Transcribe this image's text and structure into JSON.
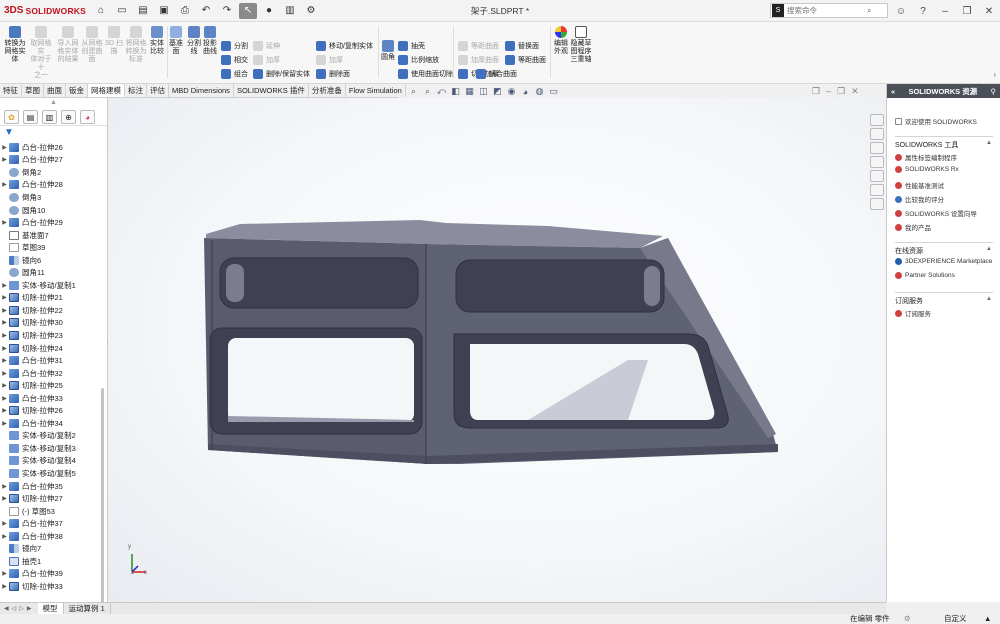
{
  "app": {
    "logo_ds": "3DS",
    "logo_text": "SOLIDWORKS",
    "doc_title": "架子.SLDPRT *"
  },
  "search": {
    "placeholder": "搜索命令"
  },
  "ribbon": {
    "convert_mesh": [
      "转换为",
      "网格实",
      "体"
    ],
    "mesh_large": [
      "取网格实",
      "体对于十",
      "之一"
    ],
    "import_mesh": [
      "导入网",
      "格实体",
      "的结果"
    ],
    "mesh_surface": [
      "从网格",
      "创建曲",
      "面"
    ],
    "scan3d": [
      "3D 扫",
      "描"
    ],
    "mesh_std": [
      "将网格",
      "转换为",
      "标准"
    ],
    "solid_compare": [
      "实体",
      "比较"
    ],
    "ref_plane": [
      "基准",
      "面"
    ],
    "split_line": [
      "分割",
      "线"
    ],
    "project_curve": [
      "投影",
      "曲线"
    ],
    "split": "分割",
    "intersect": "相交",
    "combine": "组合",
    "move_copy": "移动/复制实体",
    "extend": "延伸",
    "thicken": "加厚",
    "delete_keep": "删除/保留实体",
    "delete_face": "删除面",
    "fillet": "圆角",
    "shell": "抽壳",
    "scale": "比例缩放",
    "cut_with_surface": "使用曲面切除",
    "offset_surface": "等距曲面",
    "thicken_surface": "加厚曲面",
    "cut_thicken": "切除加厚",
    "replace_face": "替换面",
    "equidistant_surface": "等距曲面",
    "mirror_face": "镜合曲面",
    "edit_appearance": [
      "编辑",
      "外观"
    ],
    "sketch_program": [
      "隐藏草",
      "图程序",
      "三重轴"
    ]
  },
  "cmd_tabs": [
    "特征",
    "草图",
    "曲面",
    "钣金",
    "网格建模",
    "标注",
    "评估",
    "MBD Dimensions",
    "SOLIDWORKS 插件",
    "分析准备",
    "Flow Simulation"
  ],
  "active_cmd_tab": 4,
  "tree_items": [
    {
      "label": "凸台-拉伸26",
      "type": "boss",
      "expand": true
    },
    {
      "label": "凸台-拉伸27",
      "type": "boss",
      "expand": true
    },
    {
      "label": "倒角2",
      "type": "fillet",
      "expand": false
    },
    {
      "label": "凸台-拉伸28",
      "type": "boss",
      "expand": true
    },
    {
      "label": "倒角3",
      "type": "fillet",
      "expand": false
    },
    {
      "label": "圆角10",
      "type": "fillet",
      "expand": false
    },
    {
      "label": "凸台-拉伸29",
      "type": "boss",
      "expand": true
    },
    {
      "label": "基准面7",
      "type": "plane",
      "expand": false
    },
    {
      "label": "草图39",
      "type": "sketch",
      "expand": false
    },
    {
      "label": "镜向6",
      "type": "mirror",
      "expand": false
    },
    {
      "label": "圆角11",
      "type": "fillet",
      "expand": false
    },
    {
      "label": "实体-移动/复制1",
      "type": "move",
      "expand": true
    },
    {
      "label": "切除-拉伸21",
      "type": "cut",
      "expand": true
    },
    {
      "label": "切除-拉伸22",
      "type": "cut",
      "expand": true
    },
    {
      "label": "切除-拉伸30",
      "type": "cut",
      "expand": true
    },
    {
      "label": "切除-拉伸23",
      "type": "cut",
      "expand": true
    },
    {
      "label": "切除-拉伸24",
      "type": "cut",
      "expand": true
    },
    {
      "label": "凸台-拉伸31",
      "type": "boss",
      "expand": true
    },
    {
      "label": "凸台-拉伸32",
      "type": "boss",
      "expand": true
    },
    {
      "label": "切除-拉伸25",
      "type": "cut",
      "expand": true
    },
    {
      "label": "凸台-拉伸33",
      "type": "boss",
      "expand": true
    },
    {
      "label": "切除-拉伸26",
      "type": "cut",
      "expand": true
    },
    {
      "label": "凸台-拉伸34",
      "type": "boss",
      "expand": true
    },
    {
      "label": "实体-移动/复制2",
      "type": "move",
      "expand": false
    },
    {
      "label": "实体-移动/复制3",
      "type": "move",
      "expand": false
    },
    {
      "label": "实体-移动/复制4",
      "type": "move",
      "expand": false
    },
    {
      "label": "实体-移动/复制5",
      "type": "move",
      "expand": false
    },
    {
      "label": "凸台-拉伸35",
      "type": "boss",
      "expand": true
    },
    {
      "label": "切除-拉伸27",
      "type": "cut",
      "expand": true
    },
    {
      "label": "(-) 草图53",
      "type": "sketch",
      "expand": false
    },
    {
      "label": "凸台-拉伸37",
      "type": "boss",
      "expand": true
    },
    {
      "label": "凸台-拉伸38",
      "type": "boss",
      "expand": true
    },
    {
      "label": "镜向7",
      "type": "mirror",
      "expand": false
    },
    {
      "label": "抽壳1",
      "type": "shell",
      "expand": false
    },
    {
      "label": "凸台-拉伸39",
      "type": "boss",
      "expand": true
    },
    {
      "label": "切除-拉伸33",
      "type": "cut",
      "expand": true
    }
  ],
  "resources": {
    "header": "SOLIDWORKS 资源",
    "welcome": "欢迎使用 SOLIDWORKS",
    "tools_title": "SOLIDWORKS 工具",
    "tools": [
      "属性标签编制程序",
      "SOLIDWORKS Rx",
      "性能基准测试",
      "比较我的评分",
      "SOLIDWORKS 设置向导",
      "我的产品"
    ],
    "online_title": "在线资源",
    "online": [
      "3DEXPERIENCE Marketplace",
      "Partner Solutions"
    ],
    "subscription_title": "订阅服务",
    "subscription": [
      "订阅服务"
    ]
  },
  "triad": {
    "x": "x",
    "y": "y",
    "z": "z"
  },
  "bottom_tabs": [
    "模型",
    "运动算例 1"
  ],
  "status": {
    "editing": "在编辑 零件",
    "custom": "自定义"
  },
  "colors": {
    "accent_red": "#c0111f",
    "model_gray": "#5a5c6e",
    "panel_header": "#4a4f58"
  }
}
